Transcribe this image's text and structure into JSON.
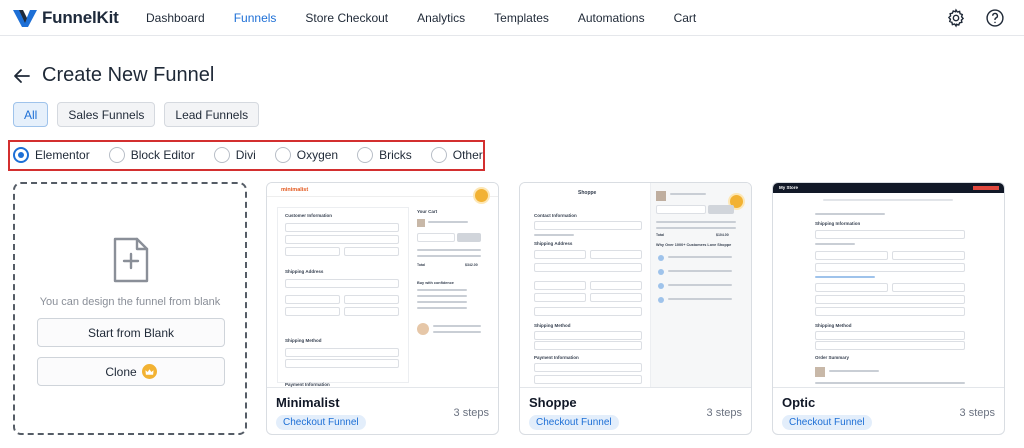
{
  "brand": {
    "name": "FunnelKit"
  },
  "nav": {
    "items": [
      {
        "label": "Dashboard",
        "active": false
      },
      {
        "label": "Funnels",
        "active": true
      },
      {
        "label": "Store Checkout",
        "active": false
      },
      {
        "label": "Analytics",
        "active": false
      },
      {
        "label": "Templates",
        "active": false
      },
      {
        "label": "Automations",
        "active": false
      },
      {
        "label": "Cart",
        "active": false
      }
    ],
    "settings_icon": "gear-icon",
    "help_icon": "question-circle-icon"
  },
  "page": {
    "title": "Create New Funnel",
    "back_icon": "arrow-left-icon"
  },
  "filters": {
    "tabs": [
      {
        "label": "All",
        "active": true
      },
      {
        "label": "Sales Funnels",
        "active": false
      },
      {
        "label": "Lead Funnels",
        "active": false
      }
    ]
  },
  "builders": {
    "selected": "Elementor",
    "options": [
      "Elementor",
      "Block Editor",
      "Divi",
      "Oxygen",
      "Bricks",
      "Other"
    ]
  },
  "blank_card": {
    "icon": "add-file-icon",
    "text": "You can design the funnel from blank",
    "start_label": "Start from Blank",
    "clone_label": "Clone",
    "clone_icon": "crown-icon"
  },
  "templates": [
    {
      "name": "Minimalist",
      "steps": "3 steps",
      "badge": "Checkout Funnel",
      "preview": {
        "brand": "minimalist",
        "sections": [
          "Customer Information",
          "Shipping Address",
          "Shipping Method",
          "Payment Information"
        ],
        "sidebar_title": "Your Cart",
        "side_heading": "Buy with confidence",
        "total_label": "Total",
        "total_value": "$342.00"
      }
    },
    {
      "name": "Shoppe",
      "steps": "3 steps",
      "badge": "Checkout Funnel",
      "preview": {
        "brand": "Shoppe",
        "sections": [
          "Contact Information",
          "Shipping Address",
          "Shipping Method",
          "Payment Information"
        ],
        "side_heading": "Why Over 1000+ Customers Love Shoppe",
        "total_label": "Total",
        "total_value": "$104.00"
      }
    },
    {
      "name": "Optic",
      "steps": "3 steps",
      "badge": "Checkout Funnel",
      "preview": {
        "brand": "My Store",
        "sections": [
          "Shipping Information",
          "Shipping Method",
          "Order Summary"
        ]
      }
    }
  ],
  "colors": {
    "accent": "#1d6fd6",
    "highlight_border": "#d32f2f",
    "premium": "#f2b233"
  }
}
